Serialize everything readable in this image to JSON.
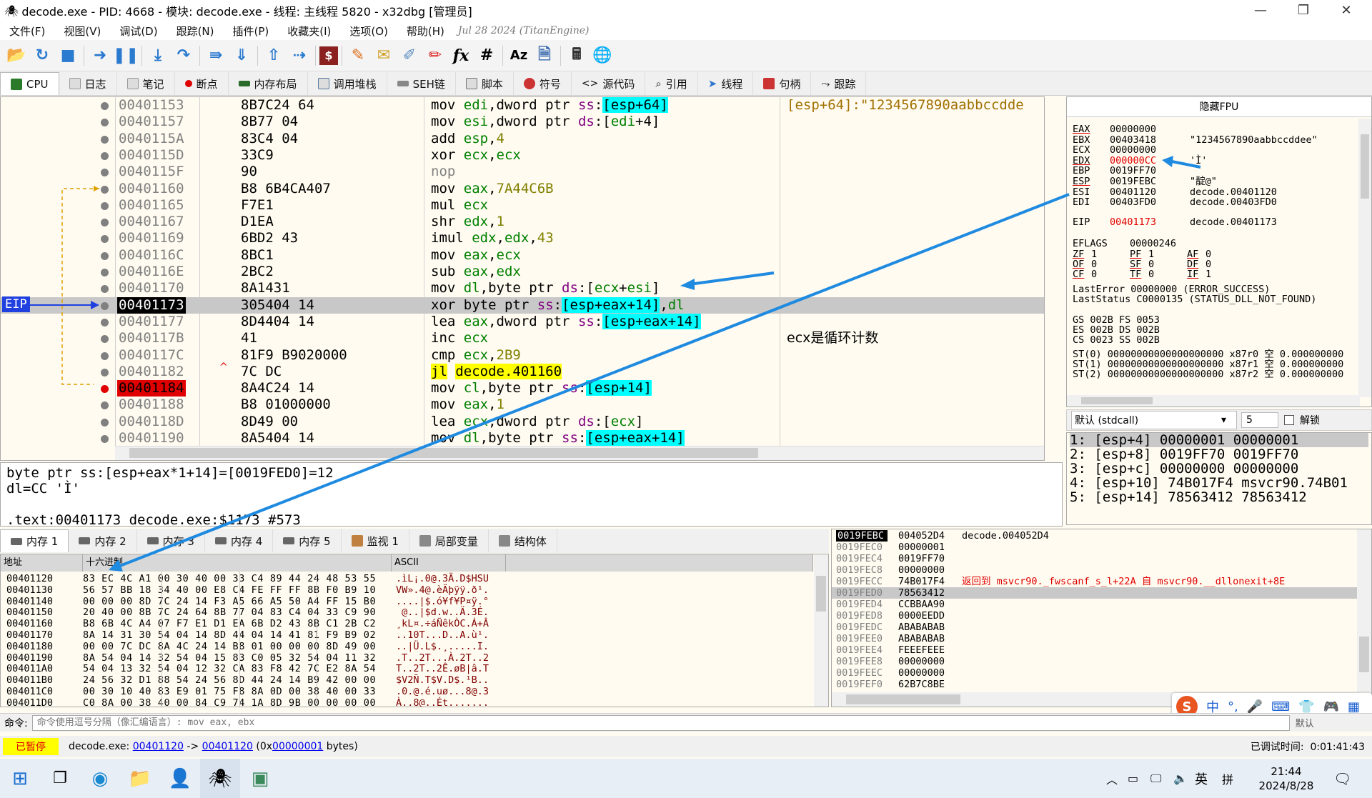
{
  "title": "decode.exe - PID: 4668 - 模块: decode.exe - 线程: 主线程 5820 - x32dbg [管理员]",
  "menu": [
    "文件(F)",
    "视图(V)",
    "调试(D)",
    "跟踪(N)",
    "插件(P)",
    "收藏夹(I)",
    "选项(O)",
    "帮助(H)"
  ],
  "build_date": "Jul 28 2024 (TitanEngine)",
  "tabs": [
    {
      "label": "CPU",
      "color": "#2a7a2a"
    },
    {
      "label": "日志",
      "color": "#888"
    },
    {
      "label": "笔记",
      "color": "#888"
    },
    {
      "label": "断点",
      "color": "#e00000"
    },
    {
      "label": "内存布局",
      "color": "#2a6a2a"
    },
    {
      "label": "调用堆栈",
      "color": "#5577aa"
    },
    {
      "label": "SEH链",
      "color": "#777"
    },
    {
      "label": "脚本",
      "color": "#777"
    },
    {
      "label": "符号",
      "color": "#cc3333"
    },
    {
      "label": "源代码",
      "color": "#555"
    },
    {
      "label": "引用",
      "color": "#777"
    },
    {
      "label": "线程",
      "color": "#3377cc"
    },
    {
      "label": "句柄",
      "color": "#cc3333"
    },
    {
      "label": "跟踪",
      "color": "#777"
    }
  ],
  "disasm": [
    {
      "addr": "00401153",
      "bytes": "8B7C24 64",
      "ins": [
        [
          "mov ",
          "ka"
        ],
        [
          "edi",
          "kr"
        ],
        [
          ",dword ptr ",
          "ka"
        ],
        [
          "ss",
          "ks"
        ],
        [
          ":",
          "ka"
        ],
        [
          "[esp+64]",
          "bk"
        ]
      ],
      "cmt": "[esp+64]:\"1234567890aabbccdde"
    },
    {
      "addr": "00401157",
      "bytes": "8B77 04",
      "ins": [
        [
          "mov ",
          "ka"
        ],
        [
          "esi",
          "kr"
        ],
        [
          ",dword ptr ",
          "ka"
        ],
        [
          "ds",
          "ks"
        ],
        [
          ":[",
          "ka"
        ],
        [
          "edi",
          "kr"
        ],
        [
          "+4]",
          "ka"
        ]
      ],
      "cmt": ""
    },
    {
      "addr": "0040115A",
      "bytes": "83C4 04",
      "ins": [
        [
          "add ",
          "ka"
        ],
        [
          "esp",
          "kr"
        ],
        [
          ",",
          "ka"
        ],
        [
          "4",
          "kn"
        ]
      ],
      "cmt": ""
    },
    {
      "addr": "0040115D",
      "bytes": "33C9",
      "ins": [
        [
          "xor ",
          "ka"
        ],
        [
          "ecx",
          "kr"
        ],
        [
          ",",
          "ka"
        ],
        [
          "ecx",
          "kr"
        ]
      ],
      "cmt": ""
    },
    {
      "addr": "0040115F",
      "bytes": "90",
      "ins": [
        [
          "nop",
          "bg"
        ]
      ],
      "cmt": ""
    },
    {
      "addr": "00401160",
      "bytes": "B8 6B4CA407",
      "ins": [
        [
          "mov ",
          "ka"
        ],
        [
          "eax",
          "kr"
        ],
        [
          ",",
          "ka"
        ],
        [
          "7A44C6B",
          "kn"
        ]
      ],
      "cmt": ""
    },
    {
      "addr": "00401165",
      "bytes": "F7E1",
      "ins": [
        [
          "mul ",
          "ka"
        ],
        [
          "ecx",
          "kr"
        ]
      ],
      "cmt": ""
    },
    {
      "addr": "00401167",
      "bytes": "D1EA",
      "ins": [
        [
          "shr ",
          "ka"
        ],
        [
          "edx",
          "kr"
        ],
        [
          ",",
          "ka"
        ],
        [
          "1",
          "kn"
        ]
      ],
      "cmt": ""
    },
    {
      "addr": "00401169",
      "bytes": "6BD2 43",
      "ins": [
        [
          "imul ",
          "ka"
        ],
        [
          "edx",
          "kr"
        ],
        [
          ",",
          "ka"
        ],
        [
          "edx",
          "kr"
        ],
        [
          ",",
          "ka"
        ],
        [
          "43",
          "kn"
        ]
      ],
      "cmt": ""
    },
    {
      "addr": "0040116C",
      "bytes": "8BC1",
      "ins": [
        [
          "mov ",
          "ka"
        ],
        [
          "eax",
          "kr"
        ],
        [
          ",",
          "ka"
        ],
        [
          "ecx",
          "kr"
        ]
      ],
      "cmt": ""
    },
    {
      "addr": "0040116E",
      "bytes": "2BC2",
      "ins": [
        [
          "sub ",
          "ka"
        ],
        [
          "eax",
          "kr"
        ],
        [
          ",",
          "ka"
        ],
        [
          "edx",
          "kr"
        ]
      ],
      "cmt": ""
    },
    {
      "addr": "00401170",
      "bytes": "8A1431",
      "ins": [
        [
          "mov ",
          "ka"
        ],
        [
          "dl",
          "kr"
        ],
        [
          ",byte ptr ",
          "ka"
        ],
        [
          "ds",
          "ks"
        ],
        [
          ":[",
          "ka"
        ],
        [
          "ecx",
          "kr"
        ],
        [
          "+",
          "ka"
        ],
        [
          "esi",
          "kr"
        ],
        [
          "]",
          "ka"
        ]
      ],
      "cmt": ""
    },
    {
      "addr": "00401173",
      "bytes": "305404 14",
      "ins": [
        [
          "xor byte ptr ",
          "ka"
        ],
        [
          "ss",
          "ks"
        ],
        [
          ":",
          "ka"
        ],
        [
          "[esp+eax+14]",
          "bk"
        ],
        [
          ",",
          "ka"
        ],
        [
          "dl",
          "kr"
        ]
      ],
      "cmt": "",
      "cur": true
    },
    {
      "addr": "00401177",
      "bytes": "8D4404 14",
      "ins": [
        [
          "lea ",
          "ka"
        ],
        [
          "eax",
          "kr"
        ],
        [
          ",dword ptr ",
          "ka"
        ],
        [
          "ss",
          "ks"
        ],
        [
          ":",
          "ka"
        ],
        [
          "[esp+eax+14]",
          "bk"
        ]
      ],
      "cmt": ""
    },
    {
      "addr": "0040117B",
      "bytes": "41",
      "ins": [
        [
          "inc ",
          "ka"
        ],
        [
          "ecx",
          "kr"
        ]
      ],
      "cmt": "ecx是循环计数"
    },
    {
      "addr": "0040117C",
      "bytes": "81F9 B9020000",
      "ins": [
        [
          "cmp ",
          "ka"
        ],
        [
          "ecx",
          "kr"
        ],
        [
          ",",
          "ka"
        ],
        [
          "2B9",
          "kn"
        ]
      ],
      "cmt": ""
    },
    {
      "addr": "00401182",
      "bytes": "7C DC",
      "ins": [
        [
          "jl",
          "jl"
        ],
        [
          " ",
          "ka"
        ],
        [
          "decode.401160",
          "jl"
        ]
      ],
      "cmt": ""
    },
    {
      "addr": "00401184",
      "bytes": "8A4C24 14",
      "ins": [
        [
          "mov ",
          "ka"
        ],
        [
          "cl",
          "kr"
        ],
        [
          ",byte ptr ",
          "ka"
        ],
        [
          "ss",
          "ks"
        ],
        [
          ":",
          "ka"
        ],
        [
          "[esp+14]",
          "bk"
        ]
      ],
      "cmt": "",
      "bp": true
    },
    {
      "addr": "00401188",
      "bytes": "B8 01000000",
      "ins": [
        [
          "mov ",
          "ka"
        ],
        [
          "eax",
          "kr"
        ],
        [
          ",",
          "ka"
        ],
        [
          "1",
          "kn"
        ]
      ],
      "cmt": ""
    },
    {
      "addr": "0040118D",
      "bytes": "8D49 00",
      "ins": [
        [
          "lea ",
          "ka"
        ],
        [
          "ecx",
          "kr"
        ],
        [
          ",dword ptr ",
          "ka"
        ],
        [
          "ds",
          "ks"
        ],
        [
          ":[",
          "ka"
        ],
        [
          "ecx",
          "kr"
        ],
        [
          "]",
          "ka"
        ]
      ],
      "cmt": ""
    },
    {
      "addr": "00401190",
      "bytes": "8A5404 14",
      "ins": [
        [
          "mov ",
          "ka"
        ],
        [
          "dl",
          "kr"
        ],
        [
          ",byte ptr ",
          "ka"
        ],
        [
          "ss",
          "ks"
        ],
        [
          ":",
          "ka"
        ],
        [
          "[esp+eax+14]",
          "bk"
        ]
      ],
      "cmt": ""
    }
  ],
  "eip_label": "EIP",
  "info": {
    "line1": "byte ptr ss:[esp+eax*1+14]=[0019FED0]=12",
    "line2": "dl=CC 'Ì'",
    "line3": ".text:00401173 decode.exe:$1173 #573"
  },
  "regs_header": "隐藏FPU",
  "regs": [
    {
      "n": "EAX",
      "v": "00000000",
      "c": "",
      "u": true
    },
    {
      "n": "EBX",
      "v": "00403418",
      "c": "\"1234567890aabbccddee\""
    },
    {
      "n": "ECX",
      "v": "00000000",
      "c": ""
    },
    {
      "n": "EDX",
      "v": "000000CC",
      "c": "'Ì'",
      "red": true,
      "u": true
    },
    {
      "n": "EBP",
      "v": "0019FF70",
      "c": ""
    },
    {
      "n": "ESP",
      "v": "0019FEBC",
      "c": "\"靛@\"",
      "u": true
    },
    {
      "n": "ESI",
      "v": "00401120",
      "c": "decode.00401120"
    },
    {
      "n": "EDI",
      "v": "00403FD0",
      "c": "decode.00403FD0"
    }
  ],
  "eip": {
    "n": "EIP",
    "v": "00401173",
    "c": "decode.00401173"
  },
  "eflags": {
    "label": "EFLAGS",
    "value": "00000246"
  },
  "flags": [
    [
      "ZF",
      "1",
      "PF",
      "1",
      "AF",
      "0"
    ],
    [
      "OF",
      "0",
      "SF",
      "0",
      "DF",
      "0"
    ],
    [
      "CF",
      "0",
      "TF",
      "0",
      "IF",
      "1"
    ]
  ],
  "lasterror": "LastError  00000000 (ERROR_SUCCESS)",
  "laststatus": "LastStatus C0000135 (STATUS_DLL_NOT_FOUND)",
  "segs": [
    "GS 002B  FS 0053",
    "ES 002B  DS 002B",
    "CS 0023  SS 002B"
  ],
  "fpu": [
    "ST(0) 00000000000000000000 x87r0 空 0.000000000",
    "ST(1) 00000000000000000000 x87r1 空 0.000000000",
    "ST(2) 00000000000000000000 x87r2 空 0.000000000"
  ],
  "callconv": {
    "value": "默认 (stdcall)",
    "count": "5",
    "unlock": "解锁"
  },
  "stack_args": [
    "1: [esp+4] 00000001 00000001",
    "2: [esp+8] 0019FF70 0019FF70",
    "3: [esp+c] 00000000 00000000",
    "4: [esp+10] 74B017F4 msvcr90.74B01",
    "5: [esp+14] 78563412 78563412"
  ],
  "memtabs": [
    "内存 1",
    "内存 2",
    "内存 3",
    "内存 4",
    "内存 5",
    "监视 1",
    "局部变量",
    "结构体"
  ],
  "dump_headers": {
    "addr": "地址",
    "hex": "十六进制",
    "ascii": "ASCII"
  },
  "dump": [
    {
      "a": "00401120",
      "h": "83 EC 4C A1 00 30 40 00 33 C4 89 44 24 48 53 55",
      "s": ".ìL¡.0@.3Ä.D$HSU"
    },
    {
      "a": "00401130",
      "h": "56 57 BB 18 34 40 00 E8 C4 FE FF FF 8B F0 B9 10",
      "s": "VW».4@.èÄþÿÿ.ð¹."
    },
    {
      "a": "00401140",
      "h": "00 00 00 8D 7C 24 14 F3 A5 66 A5 50 A4 FF 15 B0",
      "s": "....|$.ó¥f¥P¤ÿ.°"
    },
    {
      "a": "00401150",
      "h": "20 40 00 8B 7C 24 64 8B 77 04 83 C4 04 33 C9 90",
      "s": " @..|$d.w..Ä.3É."
    },
    {
      "a": "00401160",
      "h": "B8 6B 4C A4 07 F7 E1 D1 EA 6B D2 43 8B C1 2B C2",
      "s": "¸kL¤.÷áÑêkÒC.Á+Â"
    },
    {
      "a": "00401170",
      "h": "8A 14 31 30 54 04 14 8D 44 04 14 41 81 F9 B9 02",
      "s": "..10T...D..A.ù¹."
    },
    {
      "a": "00401180",
      "h": "00 00 7C DC 8A 4C 24 14 B8 01 00 00 00 8D 49 00",
      "s": "..|Ü.L$.¸.....I."
    },
    {
      "a": "00401190",
      "h": "8A 54 04 14 32 54 04 15 83 C0 05 32 54 04 11 32",
      "s": ".T..2T...À.2T..2"
    },
    {
      "a": "004011A0",
      "h": "54 04 13 32 54 04 12 32 CA 83 F8 42 7C E2 8A 54",
      "s": "T..2T..2Ê.øB|â.T"
    },
    {
      "a": "004011B0",
      "h": "24 56 32 D1 88 54 24 56 8D 44 24 14 B9 42 00 00",
      "s": "$V2Ñ.T$V.D$.¹B.."
    },
    {
      "a": "004011C0",
      "h": "00 30 10 40 83 E9 01 75 F8 8A 0D 00 38 40 00 33",
      "s": ".0.@.é.uø...8@.3"
    },
    {
      "a": "004011D0",
      "h": "C0 8A 00 38 40 00 84 C9 74 1A 8D 9B 00 00 00 00",
      "s": "À..8@..Ét......."
    }
  ],
  "stack": [
    {
      "a": "0019FEBC",
      "v": "004052D4",
      "c": "decode.004052D4",
      "top": true
    },
    {
      "a": "0019FEC0",
      "v": "00000001",
      "c": ""
    },
    {
      "a": "0019FEC4",
      "v": "0019FF70",
      "c": ""
    },
    {
      "a": "0019FEC8",
      "v": "00000000",
      "c": ""
    },
    {
      "a": "0019FECC",
      "v": "74B017F4",
      "c": "返回到 msvcr90._fwscanf_s_l+22A 自 msvcr90.__dllonexit+8E",
      "red": true
    },
    {
      "a": "0019FED0",
      "v": "78563412",
      "c": "",
      "cur": true
    },
    {
      "a": "0019FED4",
      "v": "CCBBAA90",
      "c": ""
    },
    {
      "a": "0019FED8",
      "v": "0000EEDD",
      "c": ""
    },
    {
      "a": "0019FEDC",
      "v": "ABABABAB",
      "c": ""
    },
    {
      "a": "0019FEE0",
      "v": "ABABABAB",
      "c": ""
    },
    {
      "a": "0019FEE4",
      "v": "FEEEFEEE",
      "c": ""
    },
    {
      "a": "0019FEE8",
      "v": "00000000",
      "c": ""
    },
    {
      "a": "0019FEEC",
      "v": "00000000",
      "c": ""
    },
    {
      "a": "0019FEF0",
      "v": "62B7C8BE",
      "c": ""
    }
  ],
  "cmd": {
    "label": "命令:",
    "placeholder": "命令使用逗号分隔（像汇编语言）: mov eax, ebx",
    "right": "默认"
  },
  "status": {
    "state": "已暂停",
    "prefix": "decode.exe: ",
    "a1": "00401120",
    "arrow": " -> ",
    "a2": "00401120",
    "mid": " (0x",
    "a3": "00000001",
    "suffix": " bytes)",
    "time": "已调试时间:  0:01:41:43"
  },
  "taskbar": {
    "time": "21:44",
    "date": "2024/8/28",
    "ime": "英"
  }
}
